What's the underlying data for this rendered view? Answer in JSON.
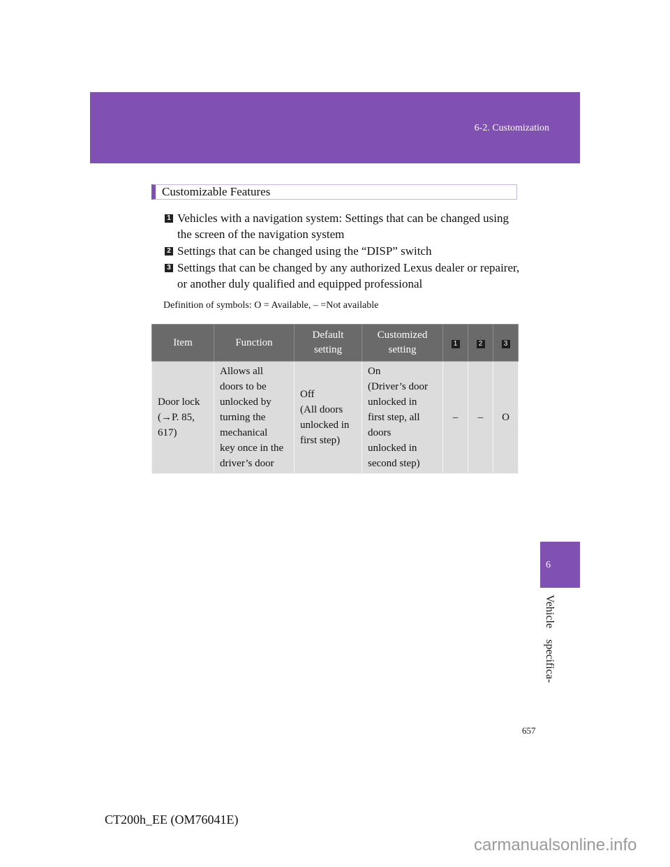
{
  "header": {
    "section": "6-2. Customization",
    "band_color": "#8050b2"
  },
  "chapter_tab": {
    "number": "6",
    "label": "Vehicle    specifica-"
  },
  "feature_heading": "Customizable Features",
  "legend": [
    {
      "icon": "1",
      "text": "Vehicles with a navigation system: Settings that can be changed using the screen of the navigation system"
    },
    {
      "icon": "2",
      "text": "Settings that can be changed using the “DISP” switch"
    },
    {
      "icon": "3",
      "text": "Settings that can be changed by any authorized Lexus dealer or repairer, or another duly qualified and equipped professional"
    }
  ],
  "definition": "Definition of symbols: O = Available, – =Not available",
  "table": {
    "headers": [
      "Item",
      "Function",
      "Default\nsetting",
      "Customized\nsetting",
      "1",
      "2",
      "3"
    ],
    "rows": [
      {
        "item": "Door lock\n(→P. 85,\n617)",
        "function": "Allows all\ndoors to be\nunlocked by\nturning the\nmechanical\nkey once in the\ndriver’s door",
        "default": "Off\n(All doors\nunlocked in\nfirst step)",
        "customized": "On\n(Driver’s door\nunlocked in\nfirst step, all\ndoors\nunlocked in\nsecond step)",
        "method1": "–",
        "method2": "–",
        "method3": "O"
      }
    ]
  },
  "footer": {
    "page_number": "657",
    "doc_code": "CT200h_EE (OM76041E)",
    "watermark": "carmanualsonline.info"
  }
}
